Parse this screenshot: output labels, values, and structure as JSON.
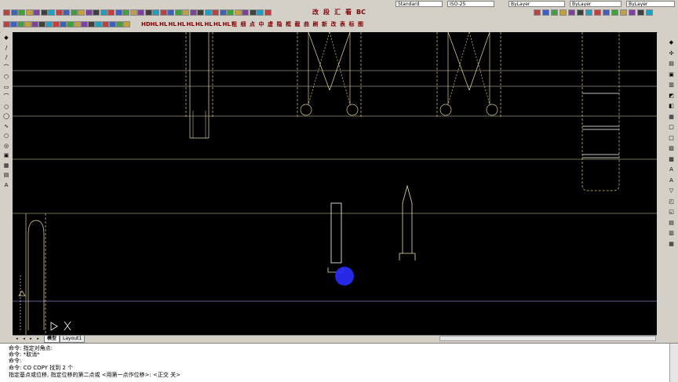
{
  "toolbar": {
    "text_style_combo": "Standard",
    "dim_style_combo": "ISO-25",
    "layer_combo": "ByLayer",
    "linetype_combo": "ByLayer",
    "lineweight_combo": "ByLayer"
  },
  "toolbar2_glyphs": [
    "改",
    "段",
    "汇",
    "看",
    "BC"
  ],
  "toolbar3_glyphs": [
    "HD",
    "HL",
    "HL",
    "HL",
    "HL",
    "HL",
    "HL",
    "HL",
    "HL",
    "HL",
    "粗",
    "细",
    "点",
    "中",
    "虚",
    "隐",
    "框",
    "截",
    "曲",
    "刷",
    "新",
    "改",
    "表",
    "标",
    "图"
  ],
  "layout_tabs": [
    "模型",
    "Layout1"
  ],
  "colors": {
    "canvas_bg": "#000000",
    "cursor_dot": "#2b2bff",
    "construction_line": "#e8e0a8",
    "guide_line": "#8080c8",
    "dashed_line": "#d8c890",
    "solid_line": "#ffffff"
  },
  "command_lines": [
    "命令: 指定对角点:",
    "命令: *取消*",
    "命令:",
    "命令: CO COPY 找到 2 个",
    "指定基点或位移, 指定位移的第二点或 <用第一点作位移>: <正交 关>"
  ],
  "ucs_icon": "ucs-icon"
}
